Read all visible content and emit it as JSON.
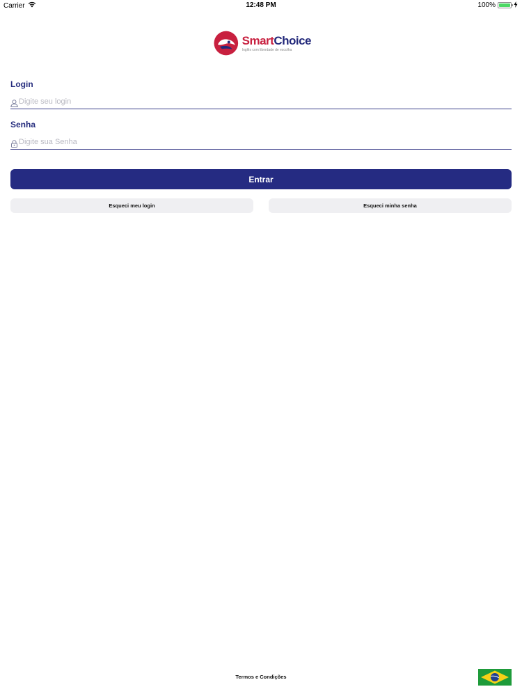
{
  "status_bar": {
    "carrier": "Carrier",
    "time": "12:48 PM",
    "battery": "100%",
    "battery_level": 1.0
  },
  "logo": {
    "name_part1": "Smart",
    "name_part2": "Choice",
    "tagline": "Inglês com liberdade de escolha"
  },
  "login": {
    "label": "Login",
    "placeholder": "Digite seu login",
    "value": "",
    "icon": "user-icon"
  },
  "password": {
    "label": "Senha",
    "placeholder": "Digite sua Senha",
    "value": "",
    "icon": "lock-icon"
  },
  "actions": {
    "submit_label": "Entrar",
    "forgot_login_label": "Esqueci meu login",
    "forgot_password_label": "Esqueci minha senha"
  },
  "footer": {
    "terms_label": "Termos e Condições",
    "language_icon": "brazil-flag-icon"
  },
  "colors": {
    "primary": "#252b82",
    "brand_red": "#c8203f",
    "secondary_button": "#efeff2"
  }
}
